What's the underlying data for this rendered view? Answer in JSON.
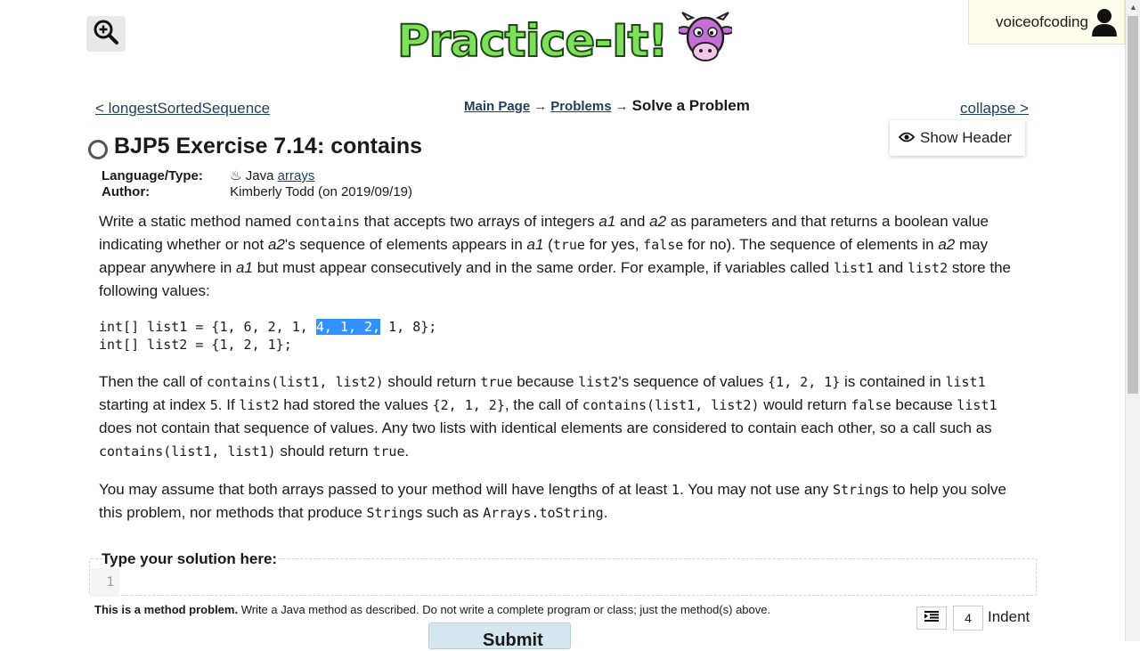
{
  "header": {
    "logo_text": "Practice-It!",
    "username": "voiceofcoding"
  },
  "nav": {
    "prev_link": "< longestSortedSequence",
    "collapse_link": "collapse >",
    "breadcrumb": {
      "main_page": "Main Page",
      "problems": "Problems",
      "arrow": "→",
      "current": "Solve a Problem"
    },
    "show_header": "Show Header"
  },
  "problem": {
    "title": "BJP5 Exercise 7.14: contains",
    "language_label": "Language/Type:",
    "language": "Java",
    "type_link": "arrays",
    "author_label": "Author:",
    "author": "Kimberly Todd (on 2019/09/19)"
  },
  "paragraph1": {
    "t1": "Write a static method named ",
    "c1": "contains",
    "t2": " that accepts two arrays of integers ",
    "i1": "a1",
    "t3": " and ",
    "i2": "a2",
    "t4": " as parameters and that returns a boolean value indicating whether or not ",
    "i3": "a2",
    "t5": "'s sequence of elements appears in ",
    "i4": "a1",
    "t6": " (",
    "c2": "true",
    "t7": " for yes, ",
    "c3": "false",
    "t8": " for no). The sequence of elements in ",
    "i5": "a2",
    "t9": " may appear anywhere in ",
    "i6": "a1",
    "t10": " but must appear consecutively and in the same order. For example, if variables called ",
    "c4": "list1",
    "t11": " and ",
    "c5": "list2",
    "t12": " store the following values:"
  },
  "code": {
    "line1_pre": "int[] list1 = {1, 6, 2, 1, ",
    "line1_hl": "4, 1, 2,",
    "line1_post": " 1, 8};",
    "line2": "int[] list2 = {1, 2, 1};"
  },
  "paragraph2": {
    "t1": "Then the call of ",
    "c1": "contains(list1, list2)",
    "t2": " should return ",
    "c2": "true",
    "t3": " because ",
    "c3": "list2",
    "t4": "'s sequence of values ",
    "c4": "{1, 2, 1}",
    "t5": " is contained in ",
    "c5": "list1",
    "t6": " starting at index ",
    "c6": "5",
    "t7": ". If ",
    "c7": "list2",
    "t8": " had stored the values ",
    "c8": "{2, 1, 2}",
    "t9": ", the call of ",
    "c9": "contains(list1, list2)",
    "t10": " would return ",
    "c10": "false",
    "t11": " because ",
    "c11": "list1",
    "t12": " does not contain that sequence of values. Any two lists with identical elements are considered to contain each other, so a call such as ",
    "c12": "contains(list1, list1)",
    "t13": " should return ",
    "c13": "true",
    "t14": "."
  },
  "paragraph3": {
    "t1": "You may assume that both arrays passed to your method will have lengths of at least ",
    "c1": "1",
    "t2": ". You may not use any ",
    "c2": "String",
    "t3": "s to help you solve this problem, nor methods that produce ",
    "c3": "String",
    "t4": "s such as ",
    "c4": "Arrays.toString",
    "t5": "."
  },
  "editor": {
    "label": "Type your solution here:",
    "line_number": "1",
    "note_bold": "This is a method problem.",
    "note_rest": " Write a Java method as described. Do not write a complete program or class; just the method(s) above.",
    "indent_value": "4",
    "indent_label": "Indent",
    "submit_label": "Submit"
  },
  "colors": {
    "link": "#1f3d5c",
    "logo_green": "#7ee05a",
    "selection": "#3390ff",
    "user_box_bg": "#fdfbea"
  }
}
